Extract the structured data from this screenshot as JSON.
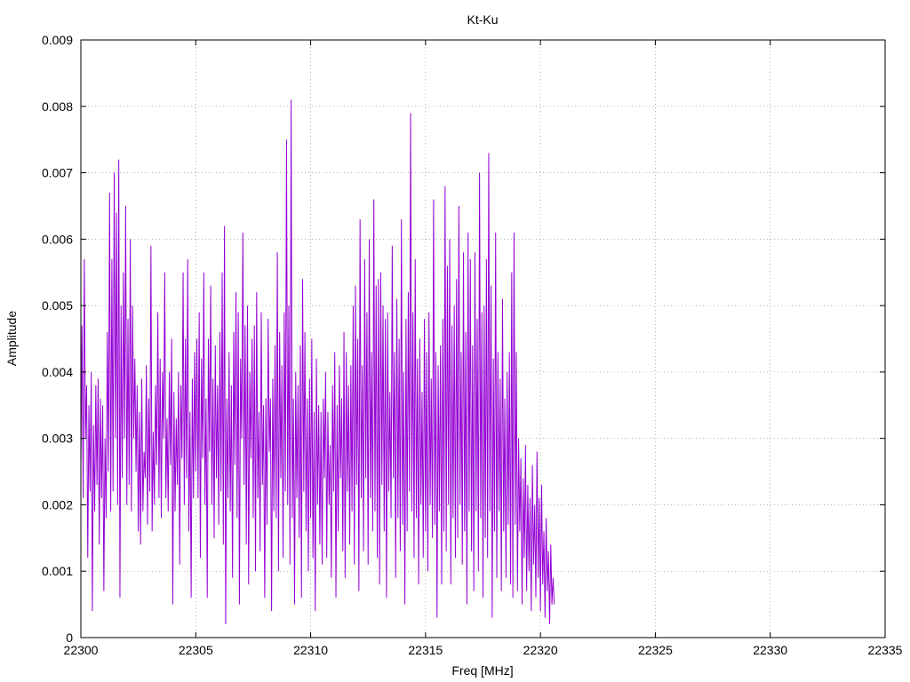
{
  "chart_data": {
    "type": "line",
    "title": "Kt-Ku",
    "xlabel": "Freq [MHz]",
    "ylabel": "Amplitude",
    "xlim": [
      22300,
      22335
    ],
    "ylim": [
      0,
      0.009
    ],
    "x_ticks": [
      "22300",
      "22305",
      "22310",
      "22315",
      "22320",
      "22325",
      "22330",
      "22335"
    ],
    "y_ticks": [
      "0",
      "0.001",
      "0.002",
      "0.003",
      "0.004",
      "0.005",
      "0.006",
      "0.007",
      "0.008",
      "0.009"
    ],
    "grid": true,
    "legend": "none",
    "series": [
      {
        "color": "#9400d3",
        "x_start": 22300,
        "x_step": 0.05,
        "values": [
          0.0026,
          0.0047,
          0.0021,
          0.0057,
          0.003,
          0.0038,
          0.0012,
          0.0035,
          0.0022,
          0.004,
          0.0004,
          0.0032,
          0.0019,
          0.0038,
          0.0023,
          0.0039,
          0.0014,
          0.0036,
          0.0021,
          0.0035,
          0.0007,
          0.003,
          0.0018,
          0.0046,
          0.0025,
          0.0067,
          0.0019,
          0.0057,
          0.0022,
          0.007,
          0.003,
          0.0064,
          0.002,
          0.0072,
          0.0006,
          0.005,
          0.0024,
          0.0055,
          0.003,
          0.0065,
          0.002,
          0.0048,
          0.0023,
          0.006,
          0.0019,
          0.005,
          0.003,
          0.0042,
          0.0025,
          0.0038,
          0.0016,
          0.0034,
          0.0014,
          0.0039,
          0.0019,
          0.0028,
          0.0024,
          0.0041,
          0.0017,
          0.0036,
          0.0022,
          0.0059,
          0.0016,
          0.0031,
          0.002,
          0.0038,
          0.0026,
          0.0049,
          0.0021,
          0.0042,
          0.0018,
          0.004,
          0.003,
          0.0055,
          0.0021,
          0.0033,
          0.0019,
          0.004,
          0.0026,
          0.0045,
          0.0005,
          0.0037,
          0.0019,
          0.0033,
          0.0023,
          0.004,
          0.0011,
          0.0038,
          0.0027,
          0.0055,
          0.002,
          0.0045,
          0.0024,
          0.0057,
          0.0016,
          0.0034,
          0.0006,
          0.0039,
          0.0021,
          0.0043,
          0.0025,
          0.0045,
          0.0021,
          0.0049,
          0.0012,
          0.0042,
          0.0027,
          0.0055,
          0.002,
          0.0036,
          0.0006,
          0.0045,
          0.0028,
          0.0053,
          0.002,
          0.0039,
          0.0015,
          0.0044,
          0.0024,
          0.0038,
          0.0017,
          0.0046,
          0.0022,
          0.0055,
          0.0014,
          0.0062,
          0.0002,
          0.0036,
          0.0021,
          0.0043,
          0.0019,
          0.0038,
          0.0009,
          0.0046,
          0.0026,
          0.0052,
          0.0018,
          0.0049,
          0.0005,
          0.0042,
          0.003,
          0.0061,
          0.0023,
          0.0047,
          0.0014,
          0.005,
          0.0008,
          0.004,
          0.0027,
          0.0045,
          0.0018,
          0.0047,
          0.001,
          0.0052,
          0.0021,
          0.0034,
          0.0013,
          0.0049,
          0.0023,
          0.0035,
          0.0006,
          0.0036,
          0.0017,
          0.0048,
          0.0028,
          0.0036,
          0.0004,
          0.0039,
          0.0019,
          0.0044,
          0.0018,
          0.0058,
          0.001,
          0.0046,
          0.0024,
          0.0041,
          0.0012,
          0.0049,
          0.0022,
          0.0075,
          0.002,
          0.005,
          0.0011,
          0.0081,
          0.0018,
          0.0036,
          0.0005,
          0.004,
          0.0021,
          0.0038,
          0.0015,
          0.0044,
          0.0006,
          0.0054,
          0.0022,
          0.0046,
          0.0016,
          0.0036,
          0.001,
          0.0039,
          0.0018,
          0.0045,
          0.0012,
          0.0034,
          0.0004,
          0.0042,
          0.002,
          0.0035,
          0.0014,
          0.0034,
          0.0011,
          0.0036,
          0.0024,
          0.004,
          0.0012,
          0.0034,
          0.002,
          0.0029,
          0.0009,
          0.0038,
          0.0022,
          0.0043,
          0.0006,
          0.0035,
          0.0016,
          0.0041,
          0.0024,
          0.0036,
          0.0013,
          0.0046,
          0.0009,
          0.0043,
          0.0022,
          0.0038,
          0.0014,
          0.0041,
          0.0019,
          0.005,
          0.0011,
          0.0053,
          0.0023,
          0.0045,
          0.0007,
          0.0063,
          0.0021,
          0.0041,
          0.0013,
          0.0057,
          0.0024,
          0.0049,
          0.0011,
          0.006,
          0.0021,
          0.0043,
          0.0016,
          0.0066,
          0.0019,
          0.0053,
          0.0012,
          0.0054,
          0.0008,
          0.0055,
          0.0023,
          0.005,
          0.0016,
          0.0048,
          0.0006,
          0.0049,
          0.0022,
          0.0037,
          0.0018,
          0.0059,
          0.0024,
          0.0043,
          0.0009,
          0.0051,
          0.0018,
          0.0045,
          0.0013,
          0.0063,
          0.0017,
          0.004,
          0.0005,
          0.0048,
          0.0016,
          0.0052,
          0.0022,
          0.0079,
          0.0019,
          0.0049,
          0.0012,
          0.0057,
          0.0018,
          0.0042,
          0.0008,
          0.0045,
          0.002,
          0.0037,
          0.0012,
          0.0048,
          0.0016,
          0.0043,
          0.001,
          0.0049,
          0.002,
          0.0039,
          0.0015,
          0.0066,
          0.0017,
          0.0043,
          0.0003,
          0.0041,
          0.0019,
          0.0044,
          0.0008,
          0.0048,
          0.0016,
          0.0068,
          0.0013,
          0.0056,
          0.002,
          0.006,
          0.0008,
          0.0047,
          0.0018,
          0.005,
          0.0012,
          0.0054,
          0.0015,
          0.0065,
          0.002,
          0.0043,
          0.0011,
          0.0058,
          0.0016,
          0.0046,
          0.0005,
          0.0061,
          0.0019,
          0.0057,
          0.0013,
          0.0044,
          0.0007,
          0.0058,
          0.0019,
          0.0048,
          0.001,
          0.007,
          0.0018,
          0.0049,
          0.0006,
          0.005,
          0.0015,
          0.0057,
          0.0012,
          0.0073,
          0.0019,
          0.0053,
          0.0003,
          0.0042,
          0.0016,
          0.0061,
          0.0009,
          0.0043,
          0.0019,
          0.0039,
          0.0007,
          0.0051,
          0.0016,
          0.0036,
          0.0009,
          0.004,
          0.0017,
          0.0043,
          0.0008,
          0.0055,
          0.0006,
          0.0061,
          0.0017,
          0.0043,
          0.0007,
          0.003,
          0.0016,
          0.0027,
          0.0005,
          0.0024,
          0.0012,
          0.0029,
          0.0007,
          0.0023,
          0.001,
          0.0021,
          0.0004,
          0.0026,
          0.0011,
          0.002,
          0.0006,
          0.0028,
          0.0009,
          0.0021,
          0.0004,
          0.0023,
          0.0008,
          0.0016,
          0.0003,
          0.0018,
          0.0007,
          0.0013,
          0.0002,
          0.0014,
          0.0005,
          0.0009,
          0.0005
        ]
      }
    ]
  }
}
